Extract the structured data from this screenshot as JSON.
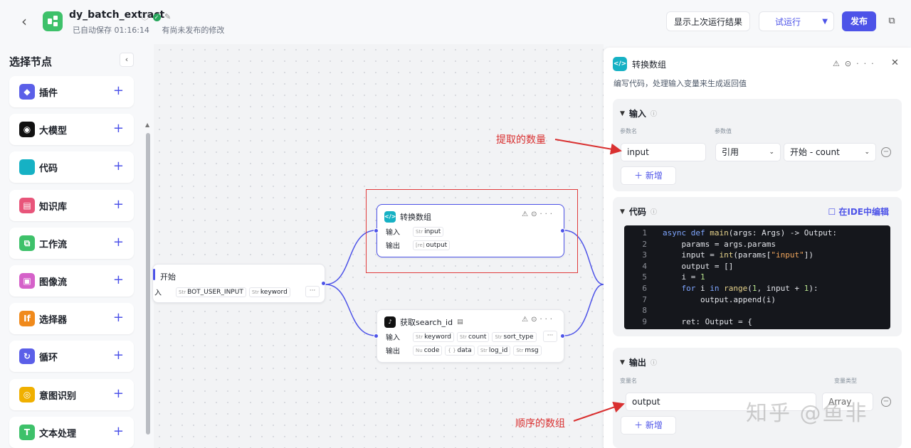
{
  "header": {
    "back": "‹",
    "title": "dy_batch_extract",
    "autosave": "已自动保存 01:16:14",
    "unpublished": "有尚未发布的修改",
    "btn_last_result": "显示上次运行结果",
    "btn_test_run": "试运行",
    "btn_publish": "发布"
  },
  "sidebar": {
    "title": "选择节点",
    "items": [
      {
        "label": "插件",
        "color": "#5b5fe8",
        "glyph": "◆"
      },
      {
        "label": "大模型",
        "color": "#111111",
        "glyph": "◉"
      },
      {
        "label": "代码",
        "color": "#16b1c4",
        "glyph": "</>"
      },
      {
        "label": "知识库",
        "color": "#e8557a",
        "glyph": "▤"
      },
      {
        "label": "工作流",
        "color": "#3ec16a",
        "glyph": "⧉"
      },
      {
        "label": "图像流",
        "color": "#d561c9",
        "glyph": "▣"
      },
      {
        "label": "选择器",
        "color": "#f08a1c",
        "glyph": "If"
      },
      {
        "label": "循环",
        "color": "#5b5fe8",
        "glyph": "↻"
      },
      {
        "label": "意图识别",
        "color": "#f0b000",
        "glyph": "◎"
      },
      {
        "label": "文本处理",
        "color": "#3ec16a",
        "glyph": "T"
      }
    ]
  },
  "canvas": {
    "start_node": {
      "title": "开始",
      "input_label": "入",
      "params": [
        {
          "type": "Str",
          "name": "BOT_USER_INPUT"
        },
        {
          "type": "Str",
          "name": "keyword"
        }
      ]
    },
    "convert_node": {
      "title": "转换数组",
      "input_label": "输入",
      "output_label": "输出",
      "inputs": [
        {
          "type": "Str",
          "name": "input"
        }
      ],
      "outputs": [
        {
          "type": "[re]",
          "name": "output"
        }
      ]
    },
    "search_node": {
      "title": "获取search_id",
      "input_label": "输入",
      "output_label": "输出",
      "inputs": [
        {
          "type": "Str",
          "name": "keyword"
        },
        {
          "type": "Str",
          "name": "count"
        },
        {
          "type": "Str",
          "name": "sort_type"
        }
      ],
      "outputs": [
        {
          "type": "Nu",
          "name": "code"
        },
        {
          "type": "{ }",
          "name": "data"
        },
        {
          "type": "Str",
          "name": "log_id"
        },
        {
          "type": "Str",
          "name": "msg"
        }
      ]
    }
  },
  "panel": {
    "title": "转换数组",
    "description": "编写代码，处理输入变量来生成返回值",
    "input_section": {
      "title": "输入",
      "col_param_name": "参数名",
      "col_param_value": "参数值",
      "param_name": "input",
      "ref_mode": "引用",
      "ref_value": "开始 - count",
      "add_label": "新增"
    },
    "code_section": {
      "title": "代码",
      "ide_label": "在IDE中编辑",
      "lines": [
        {
          "n": "1",
          "html": "<span class='kw'>async def</span> <span class='fn'>main</span>(args: Args) -> Output:"
        },
        {
          "n": "2",
          "html": "    params = args.params"
        },
        {
          "n": "3",
          "html": "    input = <span class='fn'>int</span>(params[<span class='str'>\"input\"</span>])"
        },
        {
          "n": "4",
          "html": "    output = []"
        },
        {
          "n": "5",
          "html": "    i = <span class='num'>1</span>"
        },
        {
          "n": "6",
          "html": "    <span class='kw'>for</span> i <span class='kw'>in</span> <span class='fn'>range</span>(<span class='num'>1</span>, input + <span class='num'>1</span>):"
        },
        {
          "n": "7",
          "html": "        output.append(i)"
        },
        {
          "n": "8",
          "html": ""
        },
        {
          "n": "9",
          "html": "    ret: Output = {"
        }
      ]
    },
    "output_section": {
      "title": "输出",
      "col_var_name": "变量名",
      "col_var_type": "变量类型",
      "var_name": "output",
      "var_type": "Array",
      "add_label": "新增"
    }
  },
  "annotations": {
    "count_note": "提取的数量",
    "array_note": "顺序的数组"
  },
  "watermark": "知乎 @鱼非"
}
